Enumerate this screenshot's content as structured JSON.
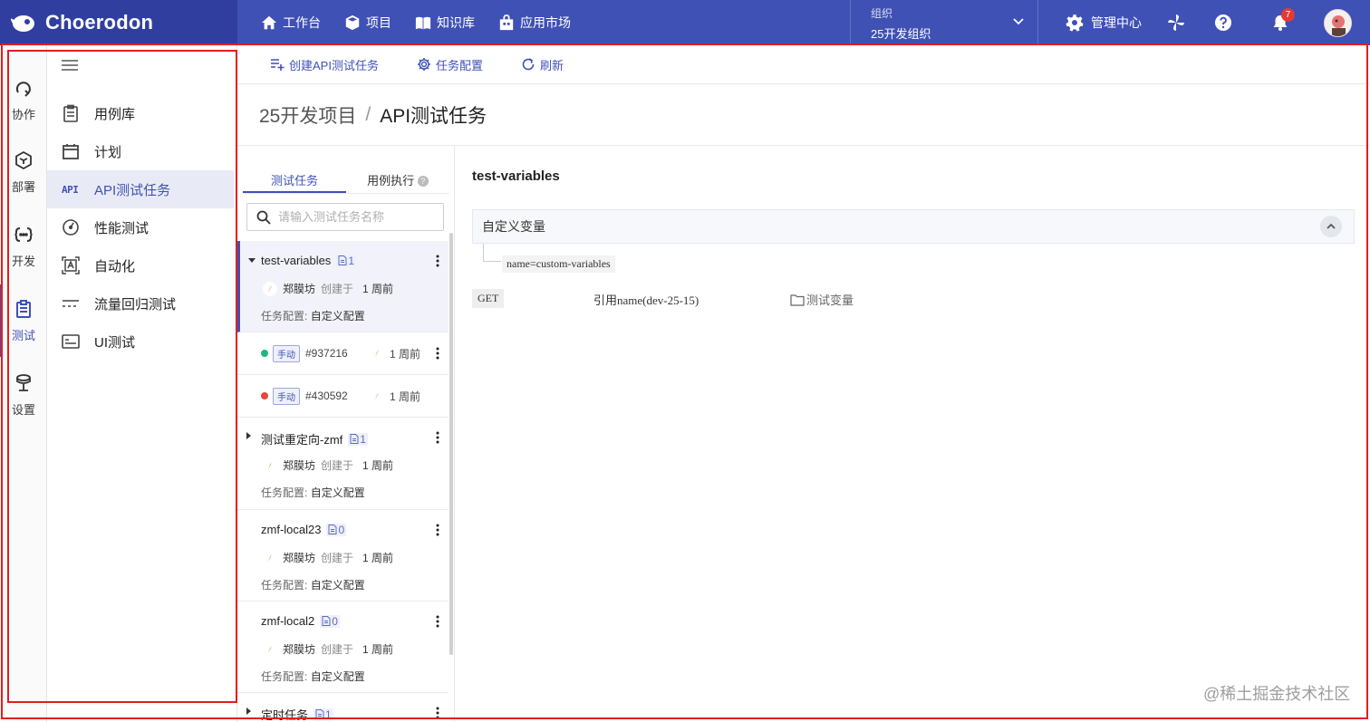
{
  "app": {
    "brand": "Choerodon"
  },
  "topnav": [
    {
      "label": "工作台",
      "icon": "home-icon"
    },
    {
      "label": "项目",
      "icon": "cube-icon"
    },
    {
      "label": "知识库",
      "icon": "book-icon"
    },
    {
      "label": "应用市场",
      "icon": "store-icon"
    }
  ],
  "org": {
    "label": "组织",
    "value": "25开发组织"
  },
  "manage": {
    "label": "管理中心"
  },
  "notifications": {
    "count": "7"
  },
  "rail": [
    {
      "label": "协作",
      "icon": "collab-icon"
    },
    {
      "label": "部署",
      "icon": "deploy-icon"
    },
    {
      "label": "开发",
      "icon": "dev-icon"
    },
    {
      "label": "测试",
      "icon": "test-icon",
      "active": true
    },
    {
      "label": "设置",
      "icon": "settings-icon"
    }
  ],
  "menu": [
    {
      "label": "用例库",
      "icon": "clipboard-icon"
    },
    {
      "label": "计划",
      "icon": "calendar-icon"
    },
    {
      "label": "API测试任务",
      "icon": "api-icon",
      "icon_text": "API",
      "active": true
    },
    {
      "label": "性能测试",
      "icon": "gauge-icon"
    },
    {
      "label": "自动化",
      "icon": "automation-icon"
    },
    {
      "label": "流量回归测试",
      "icon": "traffic-icon"
    },
    {
      "label": "UI测试",
      "icon": "ui-test-icon"
    }
  ],
  "toolbar": {
    "create": "创建API测试任务",
    "config": "任务配置",
    "refresh": "刷新"
  },
  "breadcrumb": {
    "project": "25开发项目",
    "separator": "/",
    "current": "API测试任务"
  },
  "tabs": {
    "tasks": "测试任务",
    "executions": "用例执行"
  },
  "search": {
    "placeholder": "请输入测试任务名称",
    "value": ""
  },
  "tasks": [
    {
      "name": "test-variables",
      "count": "1",
      "creator": "郑膜坊",
      "created_label": "创建于",
      "time": "1 周前",
      "config_label": "任务配置:",
      "config_value": "自定义配置",
      "expanded": true,
      "selected": true
    },
    {
      "name": "测试重定向-zmf",
      "count": "1",
      "creator": "郑膜坊",
      "created_label": "创建于",
      "time": "1 周前",
      "config_label": "任务配置:",
      "config_value": "自定义配置"
    },
    {
      "name": "zmf-local23",
      "count": "0",
      "creator": "郑膜坊",
      "created_label": "创建于",
      "time": "1 周前",
      "config_label": "任务配置:",
      "config_value": "自定义配置"
    },
    {
      "name": "zmf-local2",
      "count": "0",
      "creator": "郑膜坊",
      "created_label": "创建于",
      "time": "1 周前",
      "config_label": "任务配置:",
      "config_value": "自定义配置"
    },
    {
      "name": "定时任务",
      "count": "1"
    }
  ],
  "executions": [
    {
      "status": "success",
      "status_color": "#1db87d",
      "tag": "手动",
      "id": "#937216",
      "time": "1 周前"
    },
    {
      "status": "failed",
      "status_color": "#e8453c",
      "tag": "手动",
      "id": "#430592",
      "time": "1 周前"
    }
  ],
  "detail": {
    "title": "test-variables",
    "variables_panel": "自定义变量",
    "variable": "name=custom-variables",
    "request": {
      "method": "GET",
      "name_prefix": "引用",
      "name_rest": "name(dev-25-15)",
      "folder": "测试变量"
    }
  },
  "watermark": "@稀土掘金技术社区",
  "colors": {
    "primary": "#3f51b5",
    "brand_bg": "#303f9f",
    "annotation": "#e51c1c"
  }
}
